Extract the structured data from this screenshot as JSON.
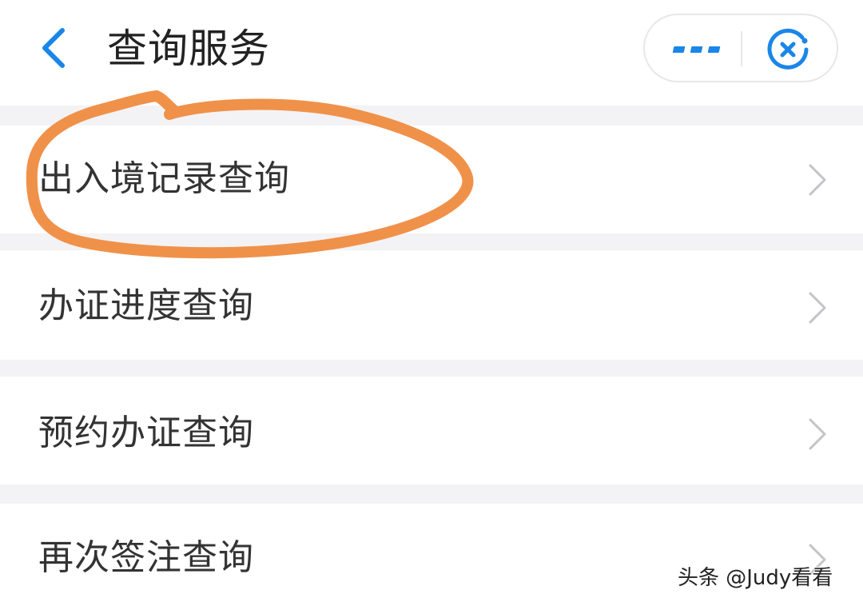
{
  "header": {
    "title": "查询服务",
    "back_icon": "chevron-left-icon",
    "more_icon": "more-dots-icon",
    "close_icon": "miniprogram-close-icon",
    "accent": "#1a86e8"
  },
  "menu": {
    "items": [
      {
        "label": "出入境记录查询"
      },
      {
        "label": "办证进度查询"
      },
      {
        "label": "预约办证查询"
      },
      {
        "label": "再次签注查询"
      }
    ],
    "chevron_icon": "chevron-right-icon"
  },
  "annotation": {
    "color": "#f0914a",
    "shape": "hand-drawn-circle"
  },
  "watermark": "头条 @Judy看看"
}
